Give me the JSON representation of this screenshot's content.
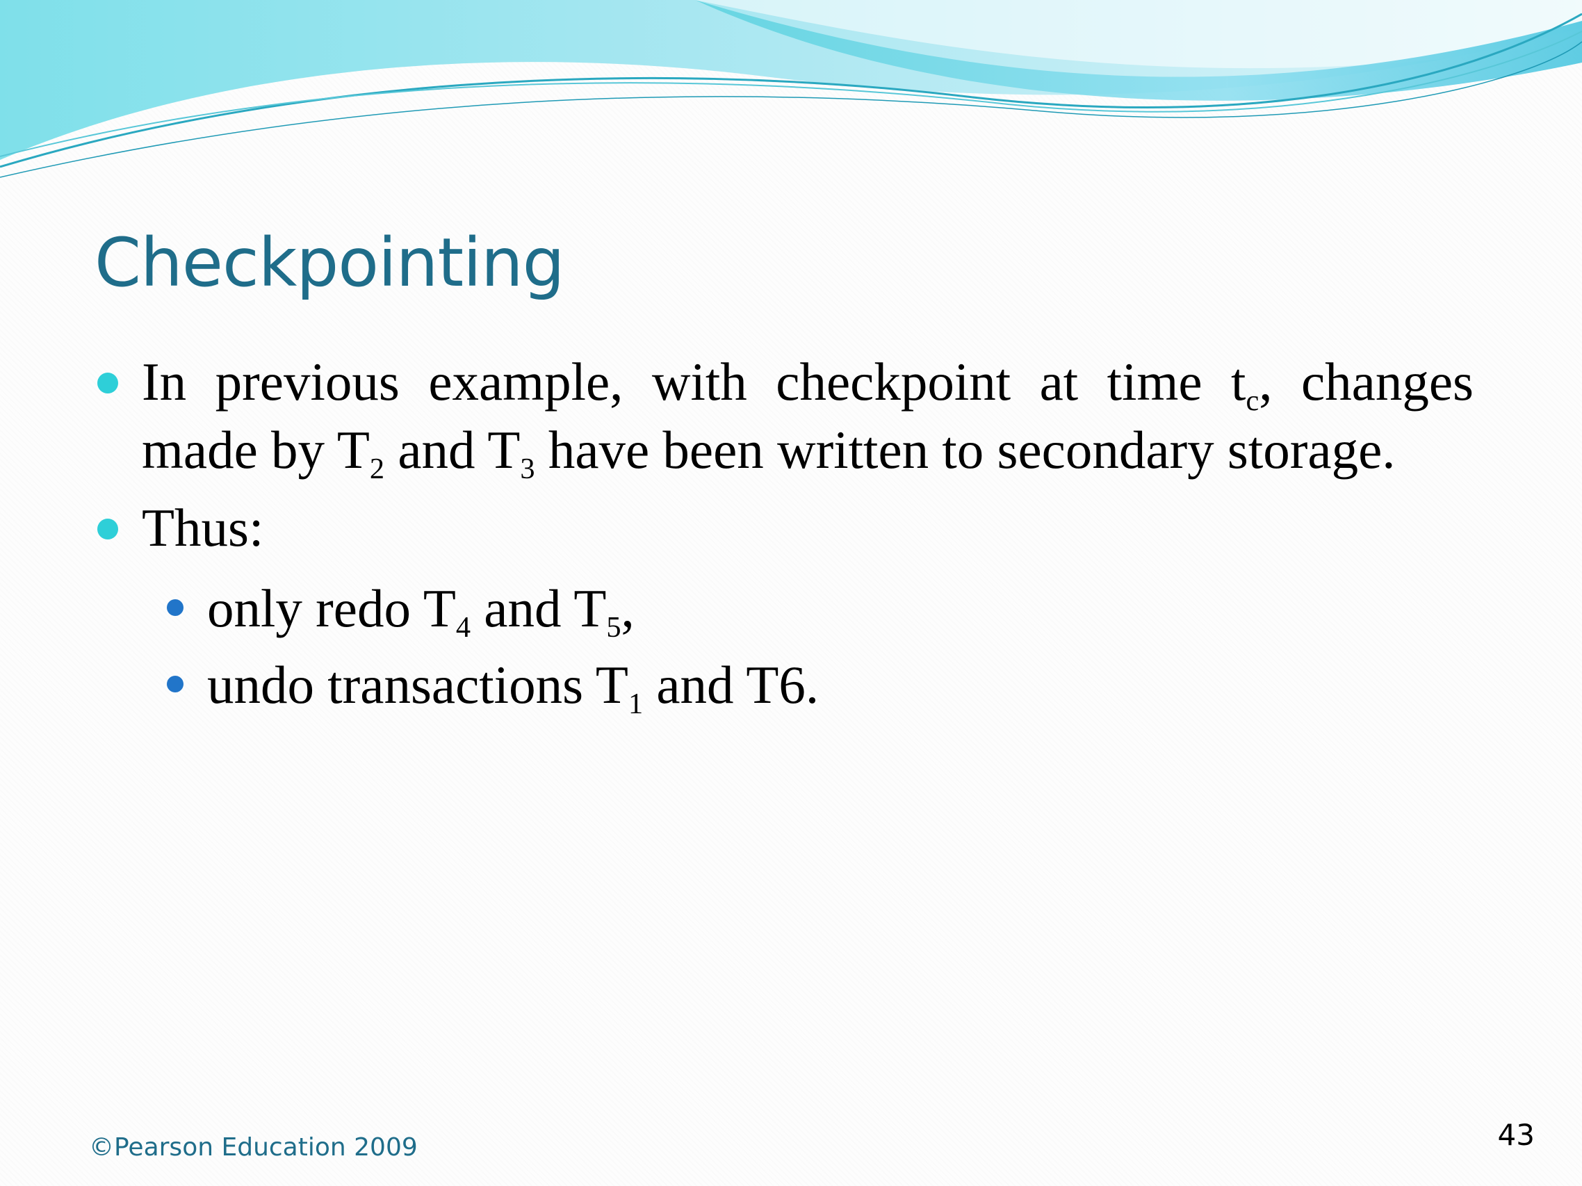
{
  "slide": {
    "title": "Checkpointing",
    "bullet1": {
      "text_a": "In previous example, with checkpoint at time t",
      "sub_c": "c",
      "text_b": ", changes made by T",
      "sub_2": "2",
      "text_c": " and T",
      "sub_3": "3",
      "text_d": " have been written to secondary storage."
    },
    "bullet2": {
      "text": "Thus:"
    },
    "sub_bullet1": {
      "text_a": "only redo T",
      "sub_4": "4",
      "text_b": " and T",
      "sub_5": "5",
      "text_c": ","
    },
    "sub_bullet2": {
      "text_a": "undo transactions T",
      "sub_1": "1",
      "text_b": " and T6."
    },
    "footer": "©Pearson Education 2009",
    "page_number": "43"
  },
  "colors": {
    "title": "#1f6d8a",
    "bullet_level1": "#2ecfd8",
    "bullet_level2": "#2175c9",
    "footer": "#1f6d8a"
  }
}
